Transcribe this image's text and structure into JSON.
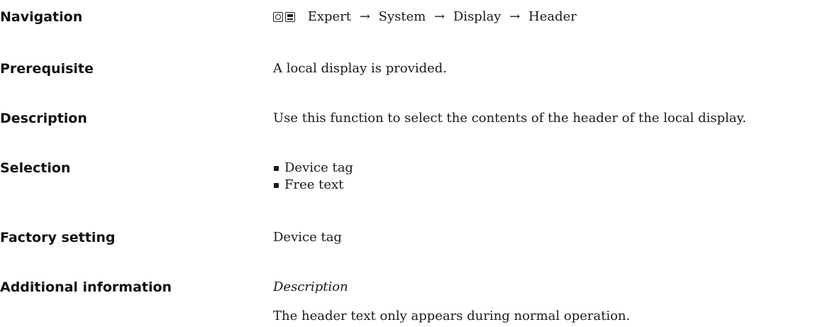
{
  "rows": {
    "navigation": {
      "label": "Navigation",
      "path": [
        "Expert",
        "System",
        "Display",
        "Header"
      ],
      "separator": "→"
    },
    "prerequisite": {
      "label": "Prerequisite",
      "value": "A local display is provided."
    },
    "description": {
      "label": "Description",
      "value": "Use this function to select the contents of the header of the local display."
    },
    "selection": {
      "label": "Selection",
      "options": [
        "Device tag",
        "Free text"
      ]
    },
    "factory_setting": {
      "label": "Factory setting",
      "value": "Device tag"
    },
    "additional_information": {
      "label": "Additional information",
      "subheading": "Description",
      "text": "The header text only appears during normal operation."
    }
  },
  "icons": [
    "keypad-icon",
    "display-icon"
  ]
}
